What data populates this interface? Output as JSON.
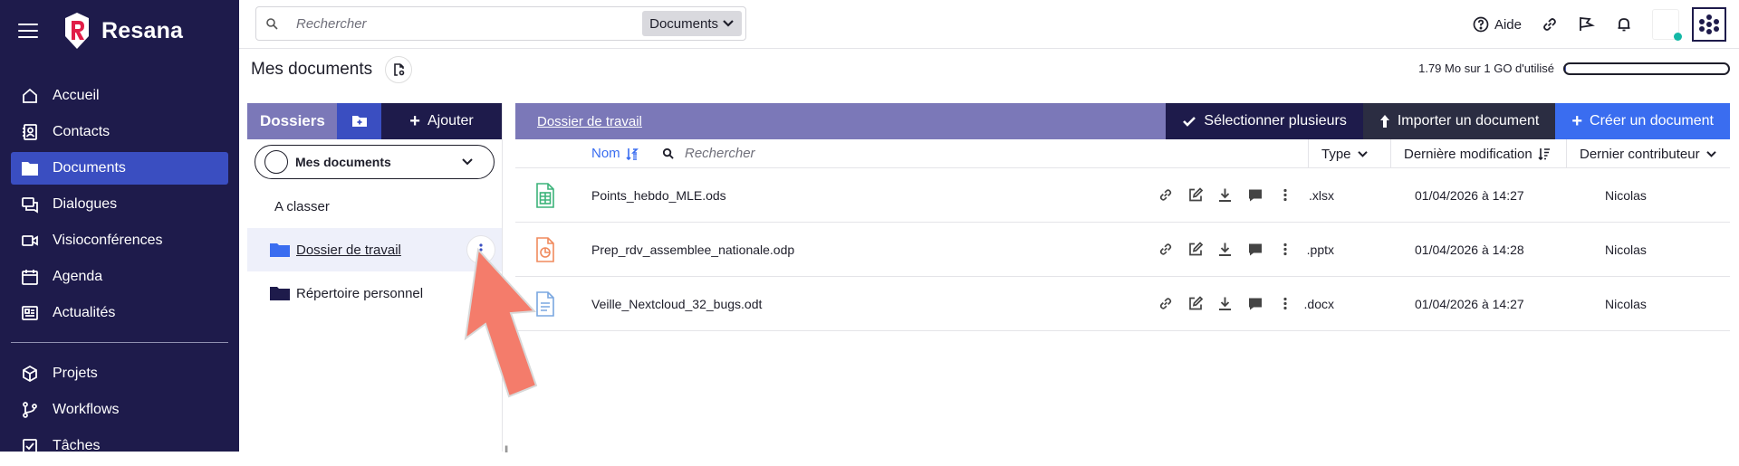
{
  "app": {
    "brand": "Resana"
  },
  "sidebar": {
    "items": [
      {
        "label": "Accueil",
        "icon": "home-icon"
      },
      {
        "label": "Contacts",
        "icon": "contacts-icon"
      },
      {
        "label": "Documents",
        "icon": "folder-icon",
        "active": true
      },
      {
        "label": "Dialogues",
        "icon": "chat-icon"
      },
      {
        "label": "Visioconférences",
        "icon": "video-icon"
      },
      {
        "label": "Agenda",
        "icon": "calendar-icon"
      },
      {
        "label": "Actualités",
        "icon": "news-icon"
      }
    ],
    "items2": [
      {
        "label": "Projets",
        "icon": "cube-icon"
      },
      {
        "label": "Workflows",
        "icon": "workflow-icon"
      },
      {
        "label": "Tâches",
        "icon": "checkbox-icon"
      }
    ]
  },
  "topbar": {
    "search_placeholder": "Rechercher",
    "search_scope": "Documents",
    "help_label": "Aide"
  },
  "page": {
    "title": "Mes documents",
    "quota_text": "1.79 Mo sur 1 GO d'utilisé",
    "quota_used_fraction": 0.002
  },
  "folders": {
    "title": "Dossiers",
    "add_label": "Ajouter",
    "root_label": "Mes documents",
    "items": [
      {
        "label": "A classer"
      },
      {
        "label": "Dossier de travail",
        "active": true
      },
      {
        "label": "Répertoire personnel"
      }
    ]
  },
  "main": {
    "breadcrumb": "Dossier de travail",
    "select_multiple_label": "Sélectionner plusieurs",
    "import_label": "Importer un document",
    "create_label": "Créer un document",
    "columns": {
      "name": "Nom",
      "search_placeholder": "Rechercher",
      "type": "Type",
      "modified": "Dernière modification",
      "contributor": "Dernier contributeur"
    },
    "rows": [
      {
        "name": "Points_hebdo_MLE.ods",
        "type": ".xlsx",
        "modified": "01/04/2026 à 14:27",
        "contributor": "Nicolas",
        "kind": "spreadsheet",
        "color": "#3cb37a"
      },
      {
        "name": "Prep_rdv_assemblee_nationale.odp",
        "type": ".pptx",
        "modified": "01/04/2026 à 14:28",
        "contributor": "Nicolas",
        "kind": "presentation",
        "color": "#f08a5d"
      },
      {
        "name": "Veille_Nextcloud_32_bugs.odt",
        "type": ".docx",
        "modified": "01/04/2026 à 14:27",
        "contributor": "Nicolas",
        "kind": "document",
        "color": "#7aa7e0"
      }
    ]
  },
  "colors": {
    "sidebar": "#1e1b4b",
    "accent": "#3a4ec1",
    "header": "#7b78b8",
    "arrow": "#f47c6b"
  }
}
